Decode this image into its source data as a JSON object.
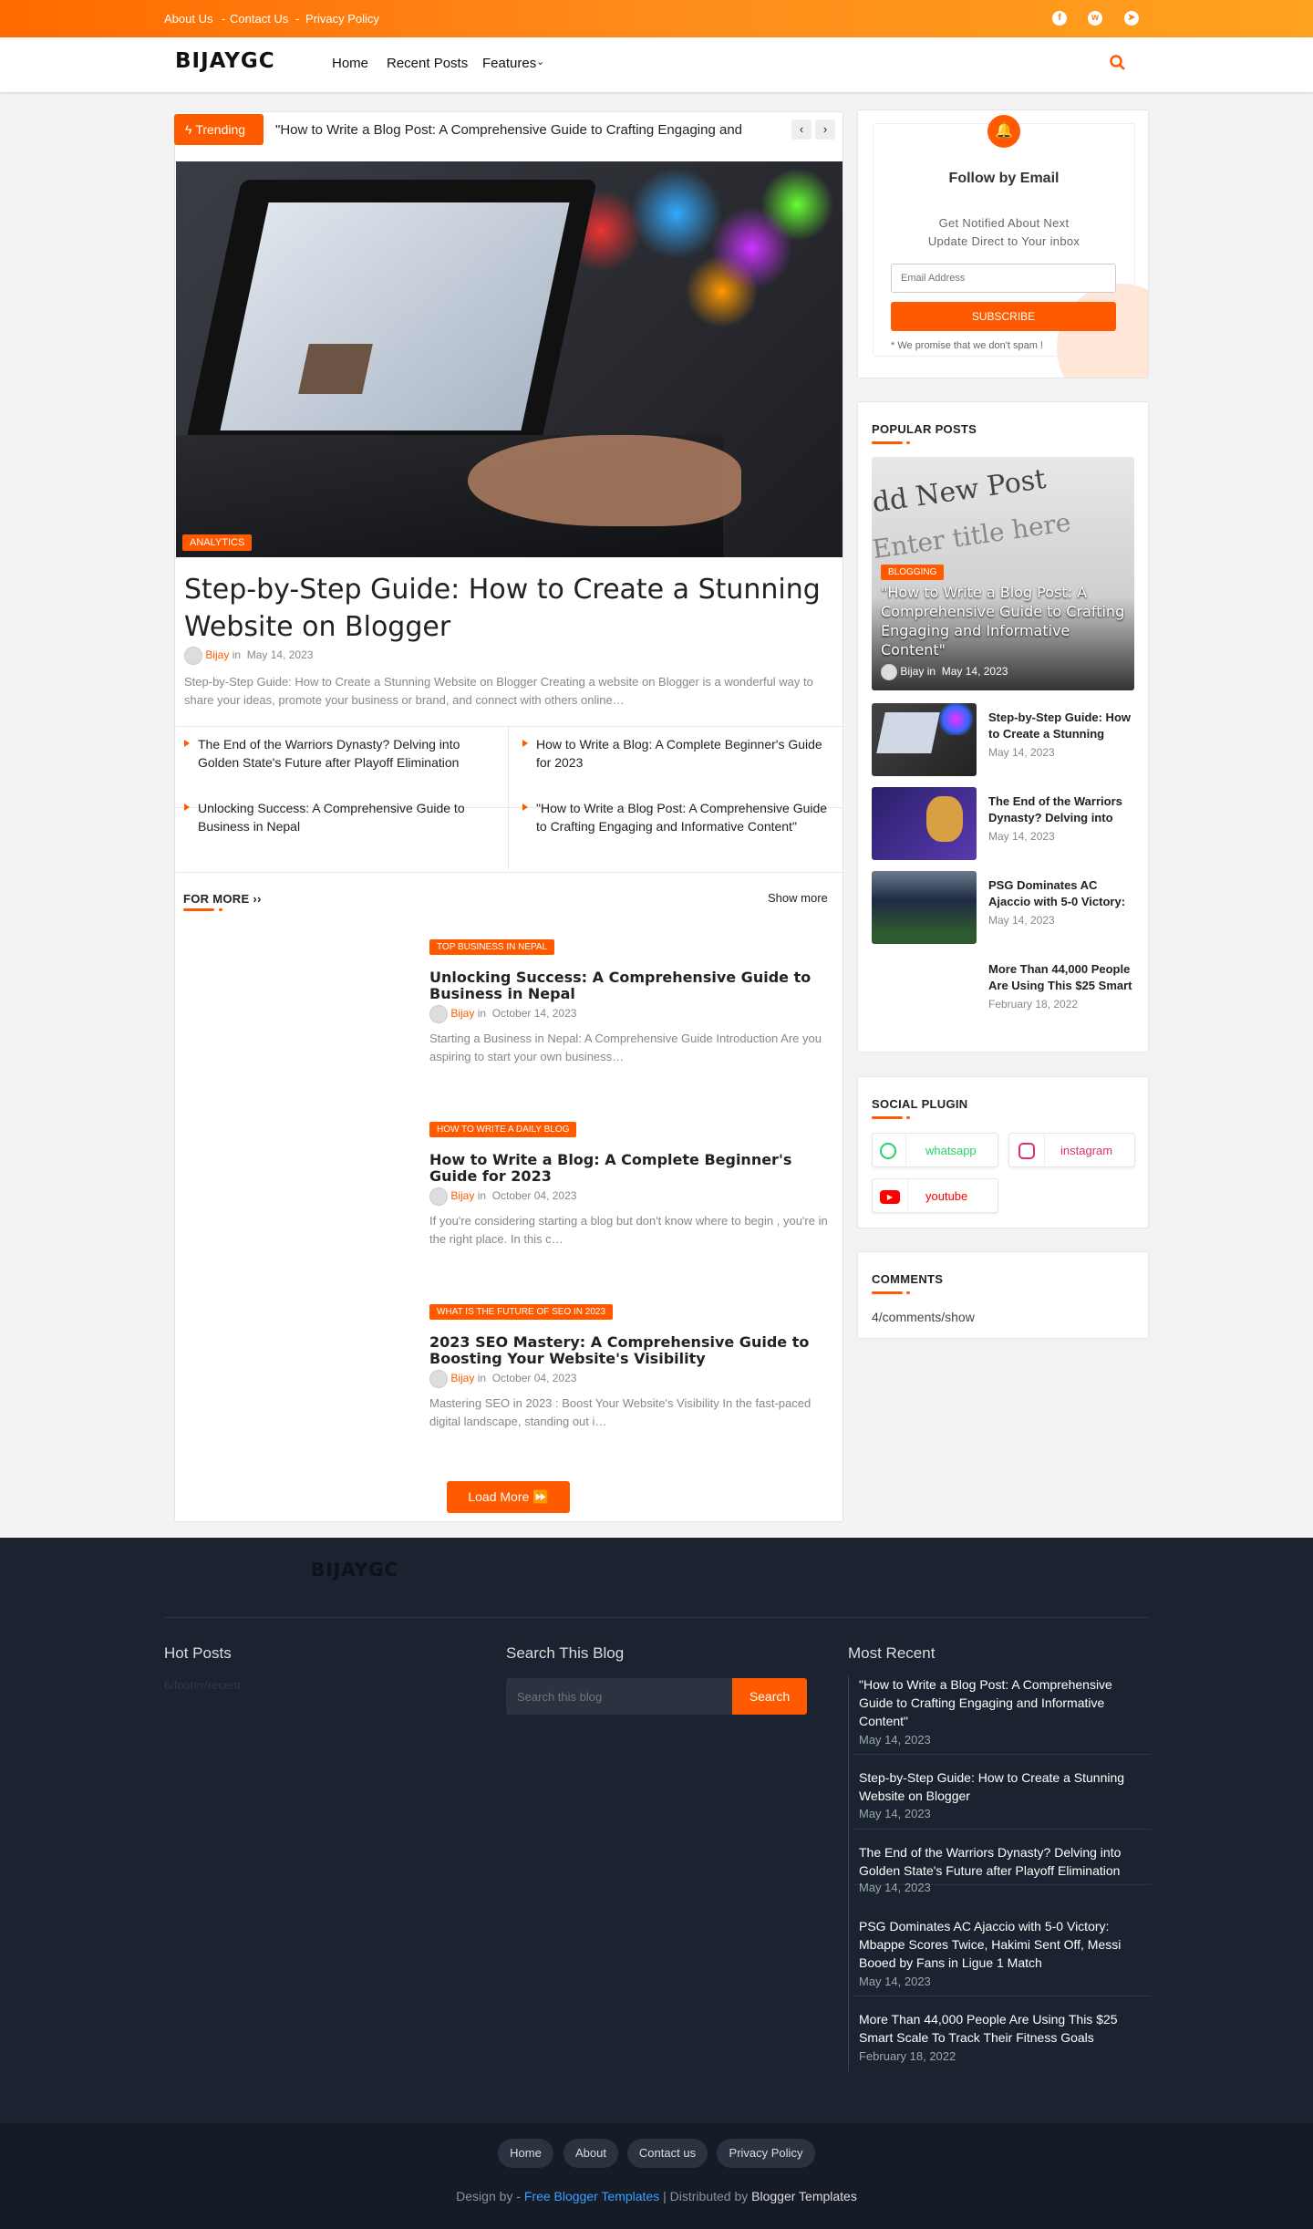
{
  "topbar": {
    "links": [
      "About Us",
      "Contact Us",
      "Privacy Policy"
    ],
    "sep": "-",
    "social": [
      {
        "icon": "facebook-icon",
        "glyph": "f"
      },
      {
        "icon": "whatsapp-icon",
        "glyph": "w"
      },
      {
        "icon": "telegram-icon",
        "glyph": "➤"
      }
    ]
  },
  "nav": {
    "logo": "BIJAYGC",
    "items": [
      "Home",
      "Recent Posts",
      "Features"
    ],
    "search_icon": "search-icon"
  },
  "trending": {
    "label": "Trending",
    "text": "\"How to Write a Blog Post: A Comprehensive Guide to Crafting Engaging and"
  },
  "hero": {
    "tag": "ANALYTICS",
    "title": "Step-by-Step Guide: How to Create a Stunning Website on Blogger",
    "author": "Bijay",
    "in": "in",
    "date": "May 14, 2023",
    "excerpt": "Step-by-Step Guide: How to Create a Stunning Website on Blogger Creating a website on Blogger is a wonderful way to share your ideas, promote your business or brand, and connect with others online…"
  },
  "related": [
    "The End of the Warriors Dynasty? Delving into Golden State's Future after Playoff Elimination",
    "How to Write a Blog: A Complete Beginner's Guide for 2023",
    "Unlocking Success: A Comprehensive Guide to Business in Nepal",
    "\"How to Write a Blog Post: A Comprehensive Guide to Crafting Engaging and Informative Content\""
  ],
  "formore": {
    "title": "FOR MORE ››",
    "show_more": "Show more",
    "load_more": "Load More ⏩"
  },
  "posts": [
    {
      "tag": "TOP BUSINESS IN NEPAL",
      "title": "Unlocking Success: A Comprehensive Guide to Business in Nepal",
      "author": "Bijay",
      "date": "October 14, 2023",
      "excerpt": "Starting a Business in Nepal: A Comprehensive Guide Introduction Are you aspiring to start your own business…"
    },
    {
      "tag": "HOW TO WRITE A DAILY BLOG",
      "title": "How to Write a Blog: A Complete Beginner's Guide for 2023",
      "author": "Bijay",
      "date": "October 04, 2023",
      "excerpt": "If you're considering starting a blog but don't know where to begin , you're in the right place. In this c…"
    },
    {
      "tag": "WHAT IS THE FUTURE OF SEO IN 2023",
      "title": "2023 SEO Mastery: A Comprehensive Guide to Boosting Your Website's Visibility",
      "author": "Bijay",
      "date": "October 04, 2023",
      "excerpt": "Mastering SEO in 2023 : Boost Your Website's Visibility In the fast-paced digital landscape, standing out i…"
    }
  ],
  "follow": {
    "title": "Follow by Email",
    "subtitle": "Get Notified About Next Update Direct to Your inbox",
    "placeholder": "Email Address",
    "button": "SUBSCRIBE",
    "note": "* We promise that we don't spam !"
  },
  "popular": {
    "title": "POPULAR POSTS",
    "featured": {
      "tag": "BLOGGING",
      "title": "\"How to Write a Blog Post: A Comprehensive Guide to Crafting Engaging and Informative Content\"",
      "author": "Bijay",
      "in": "in",
      "date": "May 14, 2023"
    },
    "items": [
      {
        "title": "Step-by-Step Guide: How to Create a Stunning",
        "date": "May 14, 2023"
      },
      {
        "title": "The End of the Warriors Dynasty? Delving into",
        "date": "May 14, 2023"
      },
      {
        "title": "PSG Dominates AC Ajaccio with 5-0 Victory:",
        "date": "May 14, 2023"
      },
      {
        "title": "More Than 44,000 People Are Using This $25 Smart",
        "date": "February 18, 2022"
      }
    ]
  },
  "social": {
    "title": "SOCIAL PLUGIN",
    "items": [
      {
        "label": "whatsapp",
        "color": "#25d366"
      },
      {
        "label": "instagram",
        "color": "#e1306c"
      },
      {
        "label": "youtube",
        "color": "#ff0000"
      }
    ]
  },
  "comments": {
    "title": "COMMENTS",
    "text": "4/comments/show"
  },
  "footer": {
    "logo": "BIJAYGC",
    "hot": "Hot Posts",
    "hot_text": "6/footer/recent",
    "search_title": "Search This Blog",
    "search_placeholder": "Search this blog",
    "search_button": "Search",
    "recent_title": "Most Recent",
    "recent": [
      {
        "title": "\"How to Write a Blog Post: A Comprehensive Guide to Crafting Engaging and Informative Content\"",
        "date": "May 14, 2023"
      },
      {
        "title": "Step-by-Step Guide: How to Create a Stunning Website on Blogger",
        "date": "May 14, 2023"
      },
      {
        "title": "The End of the Warriors Dynasty? Delving into Golden State's Future after Playoff Elimination",
        "date": "May 14, 2023"
      },
      {
        "title": "PSG Dominates AC Ajaccio with 5-0 Victory: Mbappe Scores Twice, Hakimi Sent Off, Messi Booed by Fans in Ligue 1 Match",
        "date": "May 14, 2023"
      },
      {
        "title": "More Than 44,000 People Are Using This $25 Smart Scale To Track Their Fitness Goals",
        "date": "February 18, 2022"
      }
    ]
  },
  "bottom": {
    "links": [
      "Home",
      "About",
      "Contact us",
      "Privacy Policy"
    ],
    "design_by": "Design by - ",
    "fbt": "Free Blogger Templates",
    "dist": " | Distributed by ",
    "bt": "Blogger Templates"
  },
  "colors": {
    "accent": "#ff5a00",
    "footer_bg": "#1b2230"
  }
}
